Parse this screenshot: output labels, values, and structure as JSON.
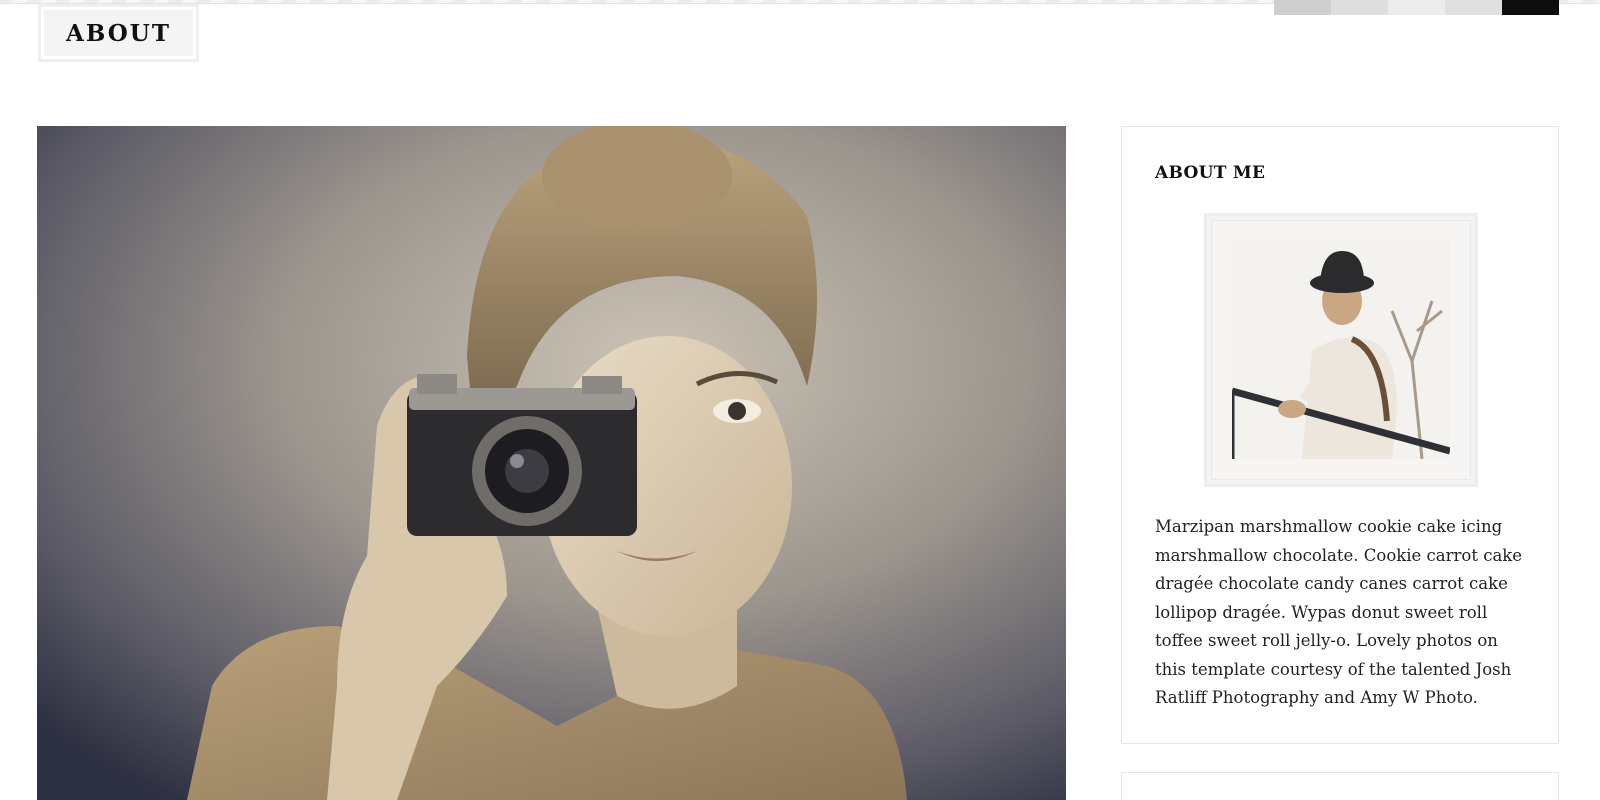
{
  "header": {
    "page_title": "ABOUT"
  },
  "theme_swatches": [
    {
      "name": "light-gray",
      "color": "#cfcfcf"
    },
    {
      "name": "lighter-gray",
      "color": "#dedede"
    },
    {
      "name": "near-white",
      "color": "#ececec"
    },
    {
      "name": "pale-gray",
      "color": "#e0e0e0"
    },
    {
      "name": "black",
      "color": "#0d0d0d"
    }
  ],
  "hero": {
    "image": "woman-with-camera-photo"
  },
  "sidebar": {
    "about_widget": {
      "title": "ABOUT ME",
      "image": "man-with-hat-photo",
      "text": "Marzipan marshmallow cookie cake icing marshmallow chocolate. Cookie carrot cake dragée chocolate candy canes carrot cake lollipop dragée. Wypas donut sweet roll toffee sweet roll jelly-o. Lovely photos on this template courtesy of the talented Josh Ratliff Photography and Amy W Photo."
    }
  },
  "colors": {
    "text": "#111111",
    "border": "#e6e6e6",
    "title_bg": "#f4f4f4"
  }
}
